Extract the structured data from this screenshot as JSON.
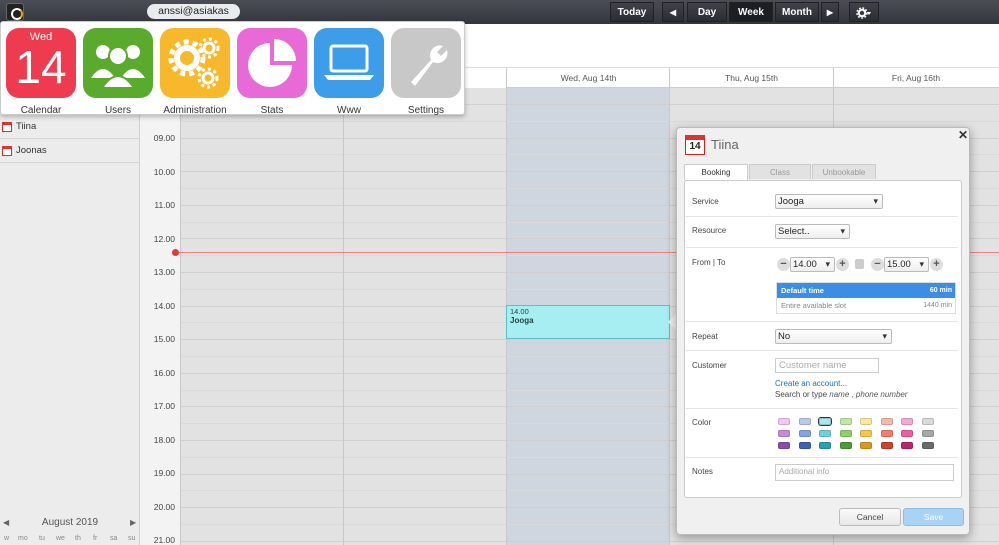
{
  "topbar": {
    "user": "anssi@asiakas",
    "today": "Today",
    "prev_icon": "◀",
    "next_icon": "▶",
    "views": [
      "Day",
      "Week",
      "Month"
    ],
    "active_view": "Week",
    "settings_icon": "gear-icon"
  },
  "launcher": {
    "apps": [
      {
        "label": "Calendar",
        "dow": "Wed",
        "num": "14",
        "color": "#ef3b4f"
      },
      {
        "label": "Users",
        "color": "#5aaa2e"
      },
      {
        "label": "Administration",
        "color": "#f7b92b"
      },
      {
        "label": "Stats",
        "color": "#e86ad6"
      },
      {
        "label": "Www",
        "color": "#3d9de8"
      },
      {
        "label": "Settings",
        "color": "#c8c8c8"
      }
    ]
  },
  "calendar": {
    "day_headers": [
      "Wed, Aug 14th",
      "Thu, Aug 15th",
      "Fri, Aug 16th"
    ],
    "resources": [
      "Tiina",
      "Joonas"
    ],
    "times": [
      "09.00",
      "10.00",
      "11.00",
      "12.00",
      "13.00",
      "14.00",
      "15.00",
      "16.00",
      "17.00",
      "18.00",
      "19.00",
      "20.00",
      "21.00"
    ],
    "event": {
      "time": "14.00",
      "title": "Jooga"
    },
    "mini_month": "August 2019",
    "mini_weekdays": [
      "w",
      "mo",
      "tu",
      "we",
      "th",
      "fr",
      "sa",
      "su"
    ]
  },
  "dialog": {
    "day_num": "14",
    "title": "Tiina",
    "tabs": [
      "Booking",
      "Class",
      "Unbookable"
    ],
    "active_tab": "Booking",
    "labels": {
      "service": "Service",
      "resource": "Resource",
      "from_to": "From | To",
      "repeat": "Repeat",
      "customer": "Customer",
      "color": "Color",
      "notes": "Notes"
    },
    "service": "Jooga",
    "resource": "Select..",
    "from": "14.00",
    "to": "15.00",
    "duration_options": [
      {
        "label": "Default time",
        "value": "60 min"
      },
      {
        "label": "Entire available slot",
        "value": "1440 min"
      }
    ],
    "repeat": "No",
    "customer_placeholder": "Customer name",
    "create_account": "Create an account...",
    "search_hint": "Search or type ",
    "search_hint_italic": "name , phone number",
    "notes_placeholder": "Additional info",
    "cancel": "Cancel",
    "save": "Save",
    "colors": [
      [
        "#f4c6f0",
        "#b7c9ec",
        "#a9e6ea",
        "#bfe8a6",
        "#f7ea9c",
        "#f6b9a8",
        "#f7a9d6",
        "#dadada"
      ],
      [
        "#c98ad9",
        "#7fa4e0",
        "#6fd0dc",
        "#8ed06a",
        "#f2c84b",
        "#ef7f6a",
        "#ec5fa7",
        "#a8a8a8"
      ],
      [
        "#8a4ea8",
        "#3e63b3",
        "#2a9fb1",
        "#4f9b3a",
        "#d7991e",
        "#c9442c",
        "#b7276d",
        "#6a6a6a"
      ]
    ],
    "selected_color": "#a9e6ea"
  }
}
